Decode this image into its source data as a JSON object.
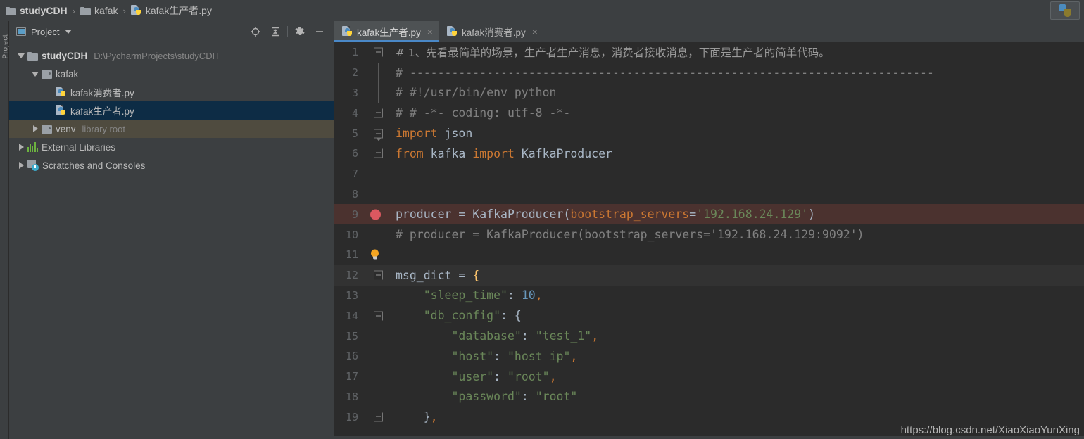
{
  "breadcrumb": {
    "items": [
      {
        "icon": "folder-icon",
        "label": "studyCDH",
        "bold": true
      },
      {
        "icon": "folder-icon",
        "label": "kafak",
        "bold": false
      },
      {
        "icon": "python-file-icon",
        "label": "kafak生产者.py",
        "bold": false
      }
    ],
    "separator": "›"
  },
  "run_config": {
    "icon": "python-icon"
  },
  "left_strip": {
    "label": "Project"
  },
  "project_panel": {
    "title": "Project",
    "tools": [
      {
        "name": "locate-icon",
        "title": "Select Opened File"
      },
      {
        "name": "collapse-all-icon",
        "title": "Collapse All"
      },
      {
        "name": "gear-icon",
        "title": "Settings"
      },
      {
        "name": "minimize-icon",
        "title": "Hide"
      }
    ],
    "tree": [
      {
        "indent": 0,
        "twisty": "down",
        "icon": "folder-icon",
        "label": "studyCDH",
        "bold": true,
        "sub": "D:\\PycharmProjects\\studyCDH",
        "state": "normal"
      },
      {
        "indent": 1,
        "twisty": "down",
        "icon": "folder-dot-icon",
        "label": "kafak",
        "bold": false,
        "sub": "",
        "state": "normal"
      },
      {
        "indent": 2,
        "twisty": "none",
        "icon": "python-file-icon",
        "label": "kafak消费者.py",
        "bold": false,
        "sub": "",
        "state": "normal"
      },
      {
        "indent": 2,
        "twisty": "none",
        "icon": "python-file-icon",
        "label": "kafak生产者.py",
        "bold": false,
        "sub": "",
        "state": "selected"
      },
      {
        "indent": 1,
        "twisty": "right",
        "icon": "folder-dot-icon",
        "label": "venv",
        "bold": false,
        "sub": "library root",
        "state": "olive"
      },
      {
        "indent": 0,
        "twisty": "right",
        "icon": "external-libraries-icon",
        "label": "External Libraries",
        "bold": false,
        "sub": "",
        "state": "normal"
      },
      {
        "indent": 0,
        "twisty": "right",
        "icon": "scratches-icon",
        "label": "Scratches and Consoles",
        "bold": false,
        "sub": "",
        "state": "normal"
      }
    ]
  },
  "editor": {
    "tabs": [
      {
        "label": "kafak生产者.py",
        "icon": "python-file-icon",
        "active": true,
        "close": "×"
      },
      {
        "label": "kafak消费者.py",
        "icon": "python-file-icon",
        "active": false,
        "close": "×"
      }
    ],
    "lines": [
      {
        "n": "1",
        "gutter": "fold-cap-top",
        "highlight": "none",
        "tokens": [
          {
            "t": "# 1、先看最简单的场景，生产者生产消息，消费者接收消息，下面是生产者的简单代码。",
            "c": "c-cjk"
          }
        ]
      },
      {
        "n": "2",
        "gutter": "line",
        "highlight": "none",
        "tokens": [
          {
            "t": "# ---------------------------------------------------------------------------",
            "c": "c-com"
          }
        ]
      },
      {
        "n": "3",
        "gutter": "line",
        "highlight": "none",
        "tokens": [
          {
            "t": "# #!/usr/bin/env python",
            "c": "c-com"
          }
        ]
      },
      {
        "n": "4",
        "gutter": "fold-cap-bot",
        "highlight": "none",
        "tokens": [
          {
            "t": "# # -*- coding: utf-8 -*-",
            "c": "c-com"
          }
        ]
      },
      {
        "n": "5",
        "gutter": "fold-arrow",
        "highlight": "none",
        "tokens": [
          {
            "t": "import",
            "c": "c-kw"
          },
          {
            "t": " json",
            "c": "c-txt"
          }
        ]
      },
      {
        "n": "6",
        "gutter": "fold-cap-bot",
        "highlight": "none",
        "tokens": [
          {
            "t": "from",
            "c": "c-kw"
          },
          {
            "t": " kafka ",
            "c": "c-txt"
          },
          {
            "t": "import",
            "c": "c-kw"
          },
          {
            "t": " KafkaProducer",
            "c": "c-txt"
          }
        ]
      },
      {
        "n": "7",
        "gutter": "none",
        "highlight": "none",
        "tokens": []
      },
      {
        "n": "8",
        "gutter": "none",
        "highlight": "none",
        "tokens": []
      },
      {
        "n": "9",
        "gutter": "breakpoint",
        "highlight": "breakpoint",
        "tokens": [
          {
            "t": "producer = KafkaProducer(",
            "c": "c-txt"
          },
          {
            "t": "bootstrap_servers",
            "c": "c-kwarg"
          },
          {
            "t": "=",
            "c": "c-txt"
          },
          {
            "t": "'192.168.24.129'",
            "c": "c-str"
          },
          {
            "t": ")",
            "c": "c-txt"
          }
        ]
      },
      {
        "n": "10",
        "gutter": "none",
        "highlight": "none",
        "tokens": [
          {
            "t": "# producer = KafkaProducer(bootstrap_servers='192.168.24.129:9092')",
            "c": "c-com"
          }
        ]
      },
      {
        "n": "11",
        "gutter": "bulb",
        "highlight": "none",
        "tokens": []
      },
      {
        "n": "12",
        "gutter": "fold-cap-top",
        "highlight": "caret",
        "tokens": [
          {
            "t": "msg_dict = ",
            "c": "c-txt"
          },
          {
            "t": "{",
            "c": "c-brk"
          }
        ]
      },
      {
        "n": "13",
        "gutter": "none",
        "highlight": "none",
        "tokens": [
          {
            "t": "    ",
            "c": "c-txt"
          },
          {
            "t": "\"sleep_time\"",
            "c": "c-str"
          },
          {
            "t": ": ",
            "c": "c-txt"
          },
          {
            "t": "10",
            "c": "c-num"
          },
          {
            "t": ",",
            "c": "c-kw"
          }
        ]
      },
      {
        "n": "14",
        "gutter": "fold-cap-top",
        "highlight": "none",
        "tokens": [
          {
            "t": "    ",
            "c": "c-txt"
          },
          {
            "t": "\"db_config\"",
            "c": "c-str"
          },
          {
            "t": ": {",
            "c": "c-txt"
          }
        ]
      },
      {
        "n": "15",
        "gutter": "none",
        "highlight": "none",
        "tokens": [
          {
            "t": "        ",
            "c": "c-txt"
          },
          {
            "t": "\"database\"",
            "c": "c-str"
          },
          {
            "t": ": ",
            "c": "c-txt"
          },
          {
            "t": "\"test_1\"",
            "c": "c-str"
          },
          {
            "t": ",",
            "c": "c-kw"
          }
        ]
      },
      {
        "n": "16",
        "gutter": "none",
        "highlight": "none",
        "tokens": [
          {
            "t": "        ",
            "c": "c-txt"
          },
          {
            "t": "\"host\"",
            "c": "c-str"
          },
          {
            "t": ": ",
            "c": "c-txt"
          },
          {
            "t": "\"host ip\"",
            "c": "c-str"
          },
          {
            "t": ",",
            "c": "c-kw"
          }
        ]
      },
      {
        "n": "17",
        "gutter": "none",
        "highlight": "none",
        "tokens": [
          {
            "t": "        ",
            "c": "c-txt"
          },
          {
            "t": "\"user\"",
            "c": "c-str"
          },
          {
            "t": ": ",
            "c": "c-txt"
          },
          {
            "t": "\"root\"",
            "c": "c-str"
          },
          {
            "t": ",",
            "c": "c-kw"
          }
        ]
      },
      {
        "n": "18",
        "gutter": "none",
        "highlight": "none",
        "tokens": [
          {
            "t": "        ",
            "c": "c-txt"
          },
          {
            "t": "\"password\"",
            "c": "c-str"
          },
          {
            "t": ": ",
            "c": "c-txt"
          },
          {
            "t": "\"root\"",
            "c": "c-str"
          }
        ]
      },
      {
        "n": "19",
        "gutter": "fold-cap-bot",
        "highlight": "none",
        "tokens": [
          {
            "t": "    }",
            "c": "c-txt"
          },
          {
            "t": ",",
            "c": "c-kw"
          }
        ]
      }
    ]
  },
  "watermark": "https://blog.csdn.net/XiaoXiaoYunXing"
}
